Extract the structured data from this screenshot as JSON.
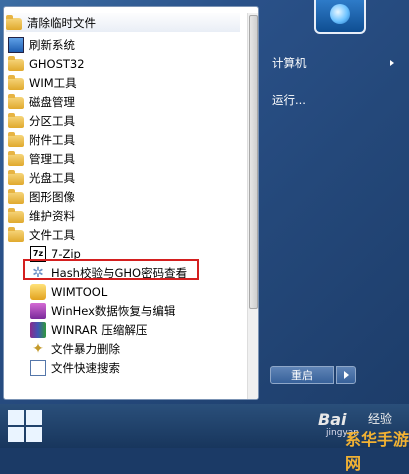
{
  "start_menu": {
    "programs": {
      "highlighted": {
        "label": "清除临时文件"
      },
      "items": [
        {
          "label": "刷新系统"
        },
        {
          "label": "GHOST32"
        },
        {
          "label": "WIM工具"
        },
        {
          "label": "磁盘管理"
        },
        {
          "label": "分区工具"
        },
        {
          "label": "附件工具"
        },
        {
          "label": "管理工具"
        },
        {
          "label": "光盘工具"
        },
        {
          "label": "图形图像"
        },
        {
          "label": "维护资料"
        },
        {
          "label": "文件工具"
        }
      ],
      "sub_items": [
        {
          "label": "7-Zip"
        },
        {
          "label": "Hash校验与GHO密码查看"
        },
        {
          "label": "WIMTOOL"
        },
        {
          "label": "WinHex数据恢复与编辑"
        },
        {
          "label": "WINRAR 压缩解压"
        },
        {
          "label": "文件暴力删除"
        },
        {
          "label": "文件快速搜索"
        }
      ]
    },
    "right_pane": {
      "computer": "计算机",
      "run": "运行..."
    },
    "restart_label": "重启"
  },
  "watermark": {
    "baidu": "Bai",
    "jingyan": "经验",
    "url": "jingyan",
    "site": "系华手游网"
  }
}
